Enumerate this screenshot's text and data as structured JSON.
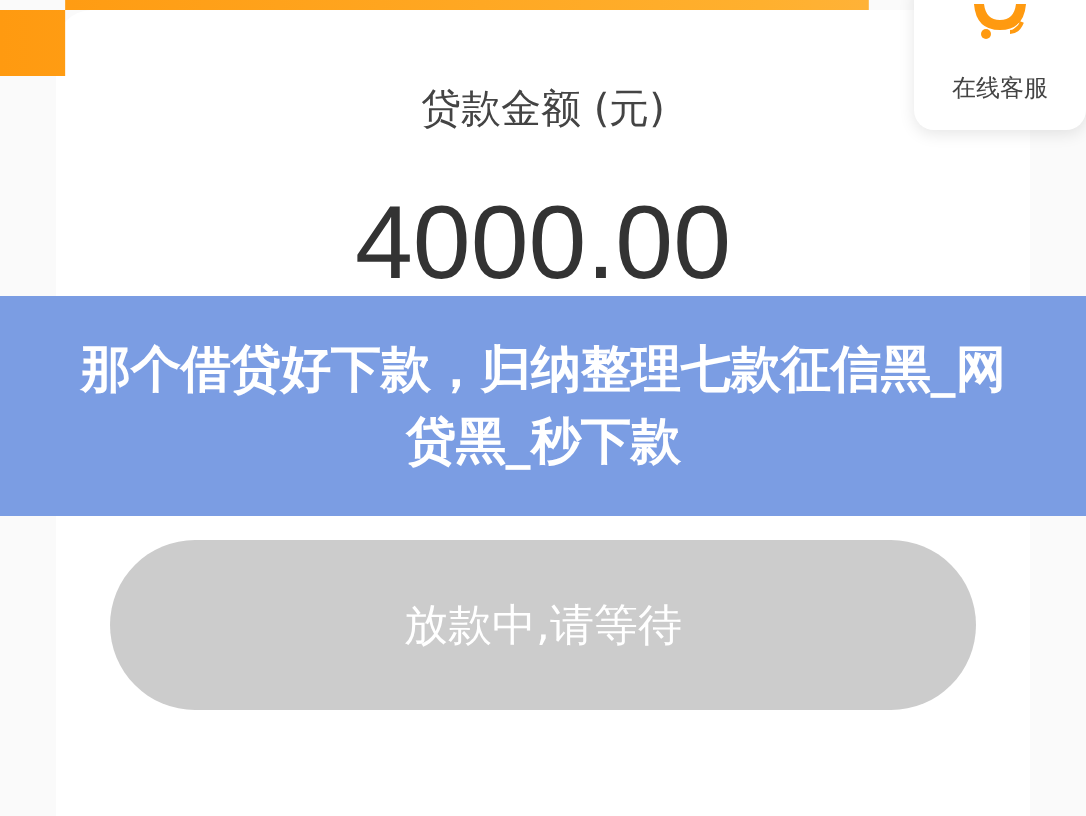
{
  "service_widget": {
    "label": "在线客服"
  },
  "loan_card": {
    "label": "贷款金额 (元)",
    "amount": "4000.00"
  },
  "status_button": {
    "label": "放款中,请等待",
    "disabled": true
  },
  "caption_banner": {
    "text": "那个借贷好下款，归纳整理七款征信黑_网贷黑_秒下款"
  }
}
